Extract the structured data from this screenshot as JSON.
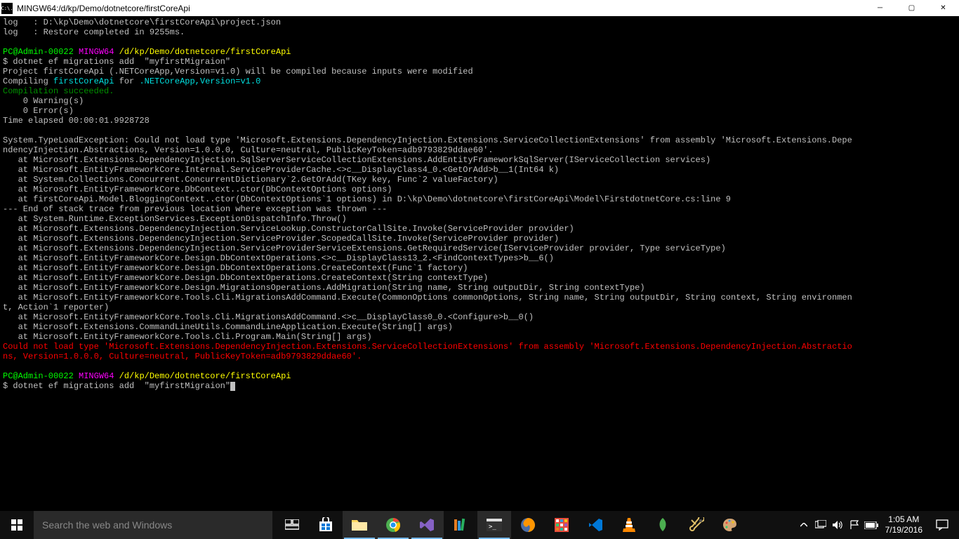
{
  "titlebar": {
    "icon_label": "C:\\.",
    "title": "MINGW64:/d/kp/Demo/dotnetcore/firstCoreApi"
  },
  "terminal": {
    "pre1": "log   : D:\\kp\\Demo\\dotnetcore\\firstCoreApi\\project.json\nlog   : Restore completed in 9255ms.\n",
    "prompt1_user": "PC@Admin-00022",
    "prompt1_sys": " MINGW64",
    "prompt1_path": " /d/kp/Demo/dotnetcore/firstCoreApi",
    "cmd1": "$ dotnet ef migrations add  \"myfirstMigraion\"",
    "compile1": "Project firstCoreApi (.NETCoreApp,Version=v1.0) will be compiled because inputs were modified",
    "compile2a": "Compiling ",
    "compile2b": "firstCoreApi",
    "compile2c": " for ",
    "compile2d": ".NETCoreApp,Version=v1.0",
    "compile_ok": "Compilation succeeded.",
    "warnings": "    0 Warning(s)\n    0 Error(s)\nTime elapsed 00:00:01.9928728\n",
    "exception": "System.TypeLoadException: Could not load type 'Microsoft.Extensions.DependencyInjection.Extensions.ServiceCollectionExtensions' from assembly 'Microsoft.Extensions.Depe\nndencyInjection.Abstractions, Version=1.0.0.0, Culture=neutral, PublicKeyToken=adb9793829ddae60'.\n   at Microsoft.Extensions.DependencyInjection.SqlServerServiceCollectionExtensions.AddEntityFrameworkSqlServer(IServiceCollection services)\n   at Microsoft.EntityFrameworkCore.Internal.ServiceProviderCache.<>c__DisplayClass4_0.<GetOrAdd>b__1(Int64 k)\n   at System.Collections.Concurrent.ConcurrentDictionary`2.GetOrAdd(TKey key, Func`2 valueFactory)\n   at Microsoft.EntityFrameworkCore.DbContext..ctor(DbContextOptions options)\n   at firstCoreApi.Model.BloggingContext..ctor(DbContextOptions`1 options) in D:\\kp\\Demo\\dotnetcore\\firstCoreApi\\Model\\FirstdotnetCore.cs:line 9\n--- End of stack trace from previous location where exception was thrown ---\n   at System.Runtime.ExceptionServices.ExceptionDispatchInfo.Throw()\n   at Microsoft.Extensions.DependencyInjection.ServiceLookup.ConstructorCallSite.Invoke(ServiceProvider provider)\n   at Microsoft.Extensions.DependencyInjection.ServiceProvider.ScopedCallSite.Invoke(ServiceProvider provider)\n   at Microsoft.Extensions.DependencyInjection.ServiceProviderServiceExtensions.GetRequiredService(IServiceProvider provider, Type serviceType)\n   at Microsoft.EntityFrameworkCore.Design.DbContextOperations.<>c__DisplayClass13_2.<FindContextTypes>b__6()\n   at Microsoft.EntityFrameworkCore.Design.DbContextOperations.CreateContext(Func`1 factory)\n   at Microsoft.EntityFrameworkCore.Design.DbContextOperations.CreateContext(String contextType)\n   at Microsoft.EntityFrameworkCore.Design.MigrationsOperations.AddMigration(String name, String outputDir, String contextType)\n   at Microsoft.EntityFrameworkCore.Tools.Cli.MigrationsAddCommand.Execute(CommonOptions commonOptions, String name, String outputDir, String context, String environmen\nt, Action`1 reporter)\n   at Microsoft.EntityFrameworkCore.Tools.Cli.MigrationsAddCommand.<>c__DisplayClass0_0.<Configure>b__0()\n   at Microsoft.Extensions.CommandLineUtils.CommandLineApplication.Execute(String[] args)\n   at Microsoft.EntityFrameworkCore.Tools.Cli.Program.Main(String[] args)",
    "error_red": "Could not load type 'Microsoft.Extensions.DependencyInjection.Extensions.ServiceCollectionExtensions' from assembly 'Microsoft.Extensions.DependencyInjection.Abstractio\nns, Version=1.0.0.0, Culture=neutral, PublicKeyToken=adb9793829ddae60'.",
    "prompt2_user": "PC@Admin-00022",
    "prompt2_sys": " MINGW64",
    "prompt2_path": " /d/kp/Demo/dotnetcore/firstCoreApi",
    "cmd2": "$ dotnet ef migrations add  \"myfirstMigraion\""
  },
  "taskbar": {
    "search_placeholder": "Search the web and Windows",
    "time": "1:05 AM",
    "date": "7/19/2016"
  }
}
